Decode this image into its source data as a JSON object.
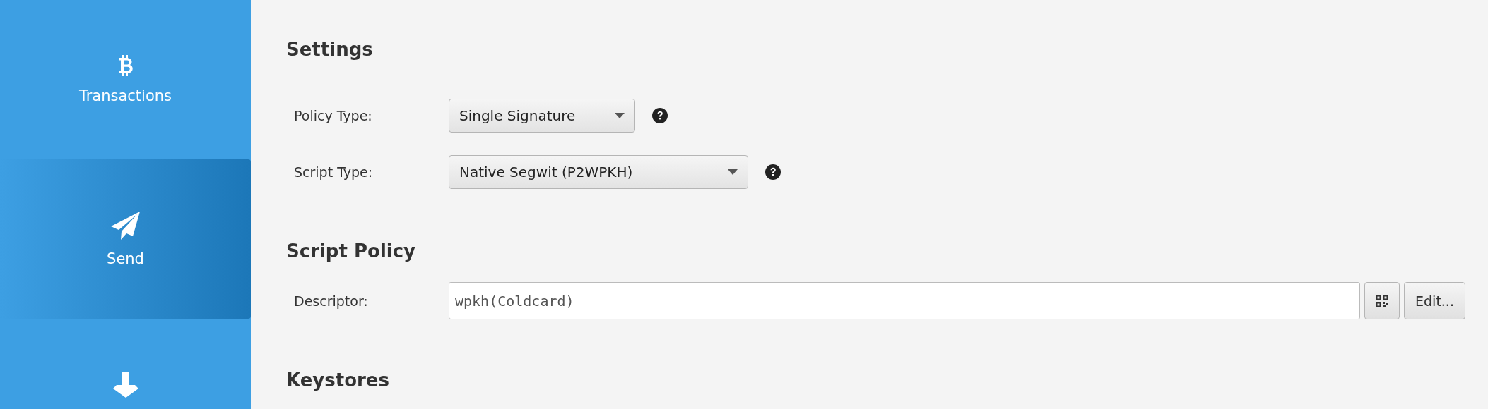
{
  "sidebar": {
    "items": [
      {
        "kind": "transactions",
        "label": "Transactions",
        "selected": false
      },
      {
        "kind": "send",
        "label": "Send",
        "selected": true
      },
      {
        "kind": "receive",
        "selected": false
      }
    ]
  },
  "settings": {
    "title": "Settings",
    "fields": [
      {
        "label": "Policy Type:",
        "value": "Single Signature"
      },
      {
        "label": "Script Type:",
        "value": "Native Segwit (P2WPKH)"
      }
    ]
  },
  "script_policy": {
    "title": "Script Policy",
    "descriptor": {
      "label": "Descriptor:",
      "value": "wpkh(Coldcard)"
    },
    "edit_button": "Edit..."
  },
  "keystores": {
    "title": "Keystores"
  }
}
